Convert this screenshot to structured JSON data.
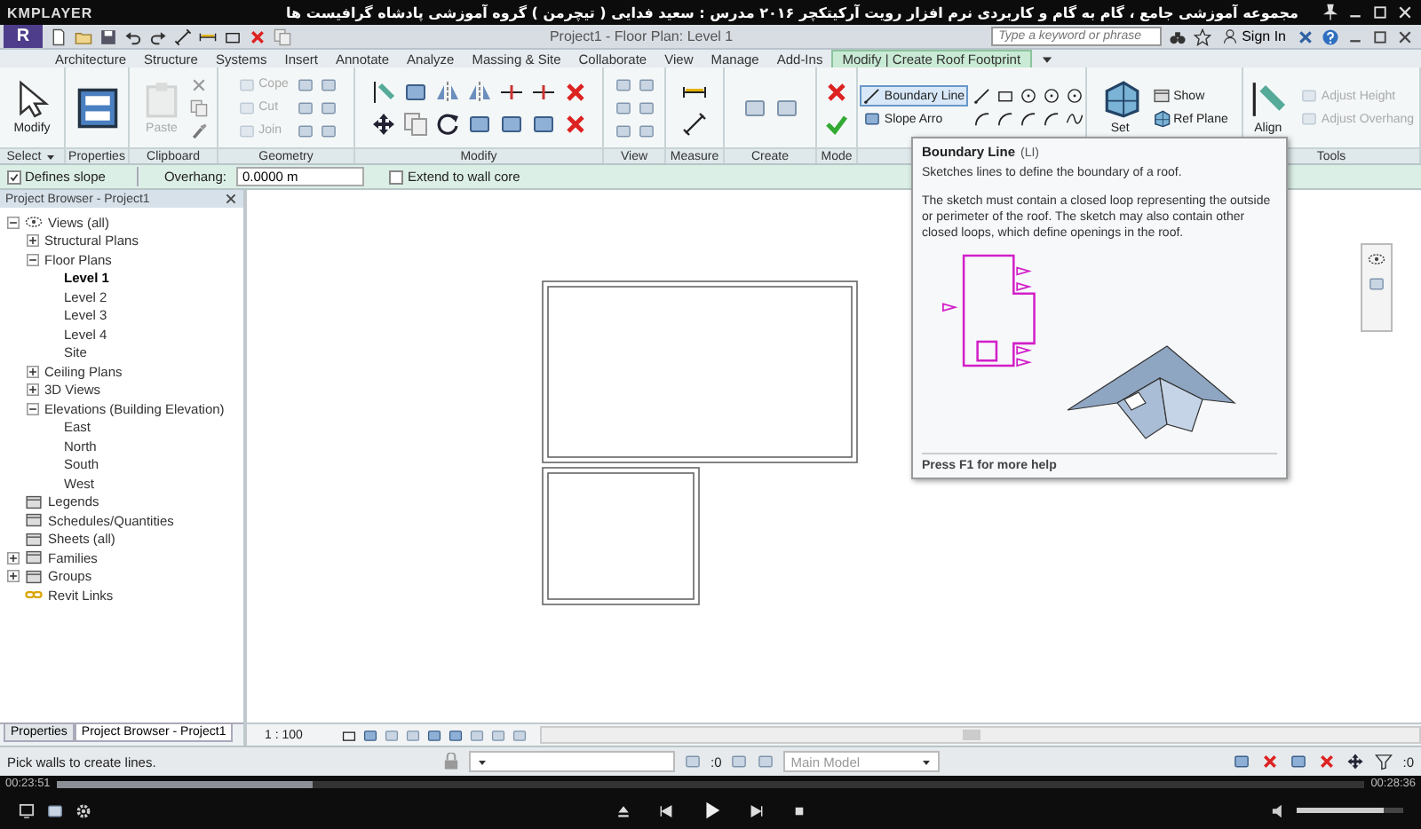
{
  "player": {
    "logo": "KMPLAYER",
    "title": "مجموعه آموزشی جامع ، گام به گام و کاربردی نرم افزار رویت آرکیتکچر ۲۰۱۶  مدرس : سعید فدایی ( تیچرمن ) گروه آموزشی پادشاه گرافیست ها",
    "elapsed": "00:23:51",
    "total": "00:28:36",
    "progress": {
      "level": 0.196
    },
    "volume": {
      "level": 0.82
    }
  },
  "revit": {
    "logo": "R",
    "title": "Project1 - Floor Plan: Level 1",
    "search": {
      "placeholder": "Type a keyword or phrase"
    },
    "sign_in": "Sign In",
    "tabs": [
      {
        "label": "Architecture",
        "selected": false
      },
      {
        "label": "Structure",
        "selected": false
      },
      {
        "label": "Systems",
        "selected": false
      },
      {
        "label": "Insert",
        "selected": false
      },
      {
        "label": "Annotate",
        "selected": false
      },
      {
        "label": "Analyze",
        "selected": false
      },
      {
        "label": "Massing & Site",
        "selected": false
      },
      {
        "label": "Collaborate",
        "selected": false
      },
      {
        "label": "View",
        "selected": false
      },
      {
        "label": "Manage",
        "selected": false
      },
      {
        "label": "Add-Ins",
        "selected": false
      },
      {
        "label": "Modify | Create Roof Footprint",
        "selected": true
      }
    ],
    "ribbon": [
      {
        "label": "Select",
        "menu": true,
        "tools": [
          {
            "label": "Modify",
            "kind": "large",
            "disabled": false,
            "selected": false
          }
        ]
      },
      {
        "label": "Properties"
      },
      {
        "label": "Clipboard",
        "tools": [
          {
            "label": "Paste",
            "kind": "large",
            "disabled": true,
            "selected": false
          }
        ]
      },
      {
        "label": "Geometry",
        "tools": [
          {
            "label": "Cope",
            "kind": "small",
            "disabled": true,
            "selected": false
          },
          {
            "label": "Cut",
            "kind": "small",
            "disabled": true,
            "selected": false
          },
          {
            "label": "Join",
            "kind": "small",
            "disabled": true,
            "selected": false
          }
        ]
      },
      {
        "label": "Modify"
      },
      {
        "label": "View"
      },
      {
        "label": "Measure"
      },
      {
        "label": "Create"
      },
      {
        "label": "Mode"
      },
      {
        "tools": [
          {
            "label": "Boundary Line",
            "kind": "small",
            "disabled": false,
            "selected": true
          },
          {
            "label": "Slope Arro",
            "kind": "small",
            "disabled": false,
            "selected": false
          }
        ]
      },
      {
        "tools": [
          {
            "label": "Set",
            "kind": "large",
            "disabled": false,
            "selected": false
          },
          {
            "label": "Show",
            "kind": "small",
            "disabled": false,
            "selected": false
          },
          {
            "label": "Ref Plane",
            "kind": "small",
            "disabled": false,
            "selected": false
          }
        ]
      },
      {
        "label": "Tools",
        "tools": [
          {
            "label": "Align",
            "kind": "large",
            "disabled": false,
            "selected": false
          },
          {
            "label": "Adjust Height",
            "kind": "small",
            "disabled": true,
            "selected": false
          },
          {
            "label": "Adjust Overhang",
            "kind": "small",
            "disabled": true,
            "selected": false
          }
        ]
      }
    ],
    "options_bar": {
      "defines_slope": {
        "label": "Defines slope",
        "checked": true
      },
      "overhang": {
        "label": "Overhang:",
        "value": "0.0000 m"
      },
      "extend_to_wall_core": {
        "label": "Extend to wall core",
        "checked": false
      }
    },
    "project_browser": {
      "title": "Project Browser - Project1",
      "tree": [
        {
          "label": "Views (all)",
          "expanded": true,
          "selected": false,
          "children": [
            {
              "label": "Structural Plans",
              "expanded": false,
              "selected": false
            },
            {
              "label": "Floor Plans",
              "expanded": true,
              "selected": false,
              "children": [
                {
                  "label": "Level 1",
                  "selected": true
                },
                {
                  "label": "Level 2",
                  "selected": false
                },
                {
                  "label": "Level 3",
                  "selected": false
                },
                {
                  "label": "Level 4",
                  "selected": false
                },
                {
                  "label": "Site",
                  "selected": false
                }
              ]
            },
            {
              "label": "Ceiling Plans",
              "expanded": false,
              "selected": false
            },
            {
              "label": "3D Views",
              "expanded": false,
              "selected": false
            },
            {
              "label": "Elevations (Building Elevation)",
              "expanded": true,
              "selected": false,
              "children": [
                {
                  "label": "East",
                  "selected": false
                },
                {
                  "label": "North",
                  "selected": false
                },
                {
                  "label": "South",
                  "selected": false
                },
                {
                  "label": "West",
                  "selected": false
                }
              ]
            }
          ]
        },
        {
          "label": "Legends",
          "selected": false
        },
        {
          "label": "Schedules/Quantities",
          "selected": false
        },
        {
          "label": "Sheets (all)",
          "selected": false
        },
        {
          "label": "Families",
          "expanded": false,
          "selected": false
        },
        {
          "label": "Groups",
          "expanded": false,
          "selected": false
        },
        {
          "label": "Revit Links",
          "selected": false
        }
      ]
    },
    "bottom_tabs": [
      {
        "label": "Properties",
        "selected": false
      },
      {
        "label": "Project Browser - Project1",
        "selected": true
      }
    ],
    "view_scale": "1 : 100",
    "tooltip": {
      "title": "Boundary Line",
      "shortcut": "(LI)",
      "summary": "Sketches lines to define the boundary of a roof.",
      "details": "The sketch must contain a closed loop representing the outside or perimeter of the roof. The sketch may also contain other closed loops, which define openings in the roof.",
      "help": "Press F1 for more help"
    },
    "status_bar": {
      "prompt": "Pick walls to create lines.",
      "editable_count": ":0",
      "model": "Main Model",
      "filter_count": ":0"
    }
  }
}
